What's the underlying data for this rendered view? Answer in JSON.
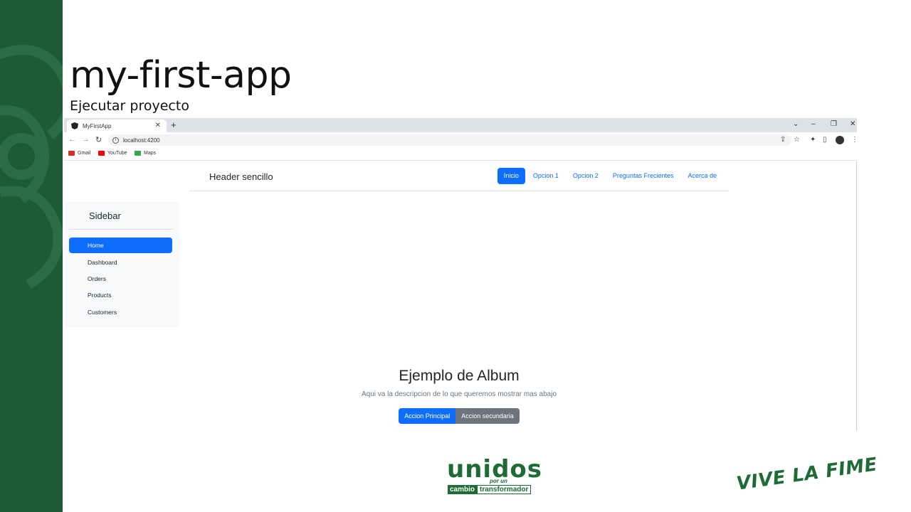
{
  "slide": {
    "title": "my-first-app",
    "subtitle": "Ejecutar proyecto"
  },
  "browser": {
    "tab_title": "MyFirstApp",
    "url": "localhost:4200",
    "bookmarks": [
      {
        "label": "Gmail",
        "icon": "gmail-icon",
        "color": "#d93025"
      },
      {
        "label": "YouTube",
        "icon": "youtube-icon",
        "color": "#ff0000"
      },
      {
        "label": "Maps",
        "icon": "maps-icon",
        "color": "#34a853"
      }
    ]
  },
  "app": {
    "header": {
      "brand": "Header sencillo",
      "nav": [
        "Inicio",
        "Opcion 1",
        "Opcion 2",
        "Preguntas Frecientes",
        "Acerca de"
      ]
    },
    "sidebar": {
      "title": "Sidebar",
      "items": [
        "Home",
        "Dashboard",
        "Orders",
        "Products",
        "Customers"
      ]
    },
    "hero": {
      "title": "Ejemplo de Album",
      "description": "Aqui va la descripcion de lo que queremos mostrar mas abajo",
      "primary_button": "Accion Principal",
      "secondary_button": "Accion secundaria"
    }
  },
  "logos": {
    "unidos_word": "unidos",
    "unidos_porun": "por un",
    "unidos_cambio": "cambio",
    "unidos_transformador": "transformador",
    "vive": "VIVE LA FIME"
  },
  "colors": {
    "brand_green": "#1e5a33",
    "primary": "#0d6efd",
    "secondary": "#6c757d"
  }
}
